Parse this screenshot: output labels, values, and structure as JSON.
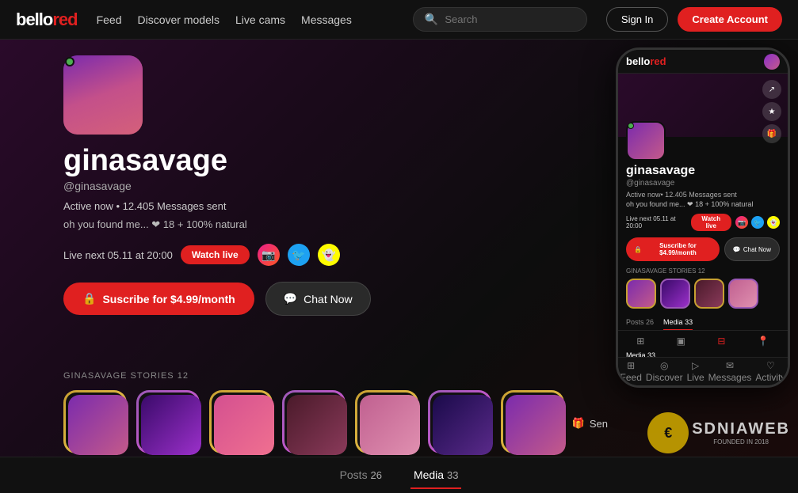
{
  "navbar": {
    "logo_bello": "bello",
    "logo_red": "red",
    "links": [
      {
        "label": "Feed",
        "id": "feed"
      },
      {
        "label": "Discover models",
        "id": "discover-models"
      },
      {
        "label": "Live cams",
        "id": "live-cams"
      },
      {
        "label": "Messages",
        "id": "messages"
      }
    ],
    "search_placeholder": "Search",
    "btn_signin": "Sign In",
    "btn_create": "Create Account"
  },
  "profile": {
    "username": "ginasavage",
    "handle": "@ginasavage",
    "active_status": "Active now",
    "messages_sent": "• 12.405 Messages sent",
    "bio": "oh you found me... ❤ 18 + 100% natural",
    "live_next": "Live next 05.11 at 20:00",
    "btn_watch_live": "Watch live",
    "btn_subscribe": "Suscribe for $4.99/month",
    "btn_chat": "Chat Now",
    "btn_send": "Sen",
    "stories_label": "GINASAVAGE STORIES 12",
    "stories_count": "12"
  },
  "tabs": [
    {
      "label": "Posts",
      "count": "26",
      "id": "posts"
    },
    {
      "label": "Media",
      "count": "33",
      "id": "media",
      "active": true
    }
  ],
  "phone": {
    "logo_bello": "bello",
    "logo_red": "red",
    "username": "ginasavage",
    "handle": "@ginasavage",
    "active": "Active now",
    "messages": "• 12.405 Messages sent",
    "bio": "oh you found me... ❤ 18 + 100% natural",
    "live_text": "Live next 05.11 at 20:00",
    "btn_watch": "Watch live",
    "btn_subscribe": "Suscribe for $4.99/month",
    "btn_chat": "Chat Now",
    "stories_label": "GINASAVAGE STORIES 12",
    "tabs": [
      {
        "label": "Posts",
        "count": "26"
      },
      {
        "label": "Media",
        "count": "33",
        "active": true
      }
    ],
    "media_label": "Media",
    "media_count": "33",
    "bottom_nav": [
      {
        "label": "Feed",
        "icon": "⊞"
      },
      {
        "label": "Discover",
        "icon": "◎"
      },
      {
        "label": "Live",
        "icon": "▷"
      },
      {
        "label": "Messages",
        "icon": "✉"
      },
      {
        "label": "Activity",
        "icon": "♡"
      }
    ]
  },
  "watermark": {
    "symbol": "€",
    "text": "SDNIAWEB",
    "sub": "FOUNDED IN 2018"
  }
}
